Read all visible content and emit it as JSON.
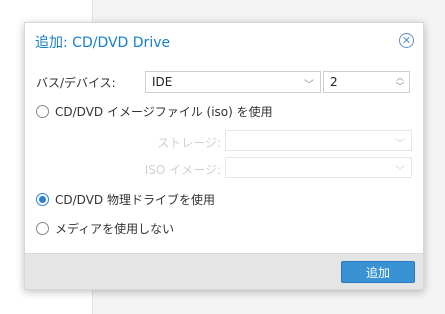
{
  "dialog": {
    "title": "追加: CD/DVD Drive",
    "close_icon": "close-circle-icon"
  },
  "bus": {
    "label": "バス/デバイス:",
    "type_value": "IDE",
    "device_value": "2"
  },
  "options": {
    "iso_label": "CD/DVD イメージファイル (iso) を使用",
    "physical_label": "CD/DVD 物理ドライブを使用",
    "none_label": "メディアを使用しない",
    "selected": "physical"
  },
  "iso": {
    "storage_label": "ストレージ:",
    "image_label": "ISO イメージ:"
  },
  "footer": {
    "add_label": "追加"
  },
  "colors": {
    "accent": "#157fcc",
    "button": "#3892d4"
  }
}
